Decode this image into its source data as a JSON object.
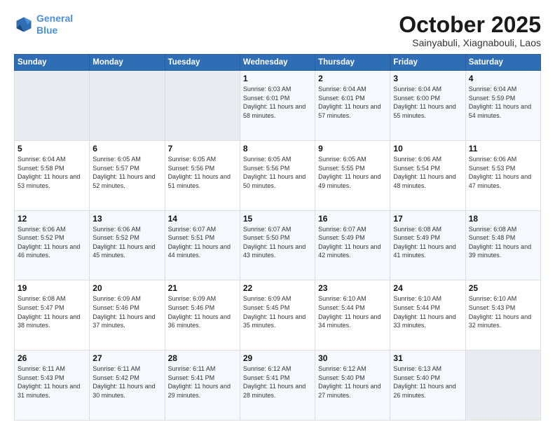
{
  "header": {
    "logo_line1": "General",
    "logo_line2": "Blue",
    "month_title": "October 2025",
    "location": "Sainyabuli, Xiagnabouli, Laos"
  },
  "weekdays": [
    "Sunday",
    "Monday",
    "Tuesday",
    "Wednesday",
    "Thursday",
    "Friday",
    "Saturday"
  ],
  "weeks": [
    [
      {
        "day": "",
        "sunrise": "",
        "sunset": "",
        "daylight": ""
      },
      {
        "day": "",
        "sunrise": "",
        "sunset": "",
        "daylight": ""
      },
      {
        "day": "",
        "sunrise": "",
        "sunset": "",
        "daylight": ""
      },
      {
        "day": "1",
        "sunrise": "Sunrise: 6:03 AM",
        "sunset": "Sunset: 6:01 PM",
        "daylight": "Daylight: 11 hours and 58 minutes."
      },
      {
        "day": "2",
        "sunrise": "Sunrise: 6:04 AM",
        "sunset": "Sunset: 6:01 PM",
        "daylight": "Daylight: 11 hours and 57 minutes."
      },
      {
        "day": "3",
        "sunrise": "Sunrise: 6:04 AM",
        "sunset": "Sunset: 6:00 PM",
        "daylight": "Daylight: 11 hours and 55 minutes."
      },
      {
        "day": "4",
        "sunrise": "Sunrise: 6:04 AM",
        "sunset": "Sunset: 5:59 PM",
        "daylight": "Daylight: 11 hours and 54 minutes."
      }
    ],
    [
      {
        "day": "5",
        "sunrise": "Sunrise: 6:04 AM",
        "sunset": "Sunset: 5:58 PM",
        "daylight": "Daylight: 11 hours and 53 minutes."
      },
      {
        "day": "6",
        "sunrise": "Sunrise: 6:05 AM",
        "sunset": "Sunset: 5:57 PM",
        "daylight": "Daylight: 11 hours and 52 minutes."
      },
      {
        "day": "7",
        "sunrise": "Sunrise: 6:05 AM",
        "sunset": "Sunset: 5:56 PM",
        "daylight": "Daylight: 11 hours and 51 minutes."
      },
      {
        "day": "8",
        "sunrise": "Sunrise: 6:05 AM",
        "sunset": "Sunset: 5:56 PM",
        "daylight": "Daylight: 11 hours and 50 minutes."
      },
      {
        "day": "9",
        "sunrise": "Sunrise: 6:05 AM",
        "sunset": "Sunset: 5:55 PM",
        "daylight": "Daylight: 11 hours and 49 minutes."
      },
      {
        "day": "10",
        "sunrise": "Sunrise: 6:06 AM",
        "sunset": "Sunset: 5:54 PM",
        "daylight": "Daylight: 11 hours and 48 minutes."
      },
      {
        "day": "11",
        "sunrise": "Sunrise: 6:06 AM",
        "sunset": "Sunset: 5:53 PM",
        "daylight": "Daylight: 11 hours and 47 minutes."
      }
    ],
    [
      {
        "day": "12",
        "sunrise": "Sunrise: 6:06 AM",
        "sunset": "Sunset: 5:52 PM",
        "daylight": "Daylight: 11 hours and 46 minutes."
      },
      {
        "day": "13",
        "sunrise": "Sunrise: 6:06 AM",
        "sunset": "Sunset: 5:52 PM",
        "daylight": "Daylight: 11 hours and 45 minutes."
      },
      {
        "day": "14",
        "sunrise": "Sunrise: 6:07 AM",
        "sunset": "Sunset: 5:51 PM",
        "daylight": "Daylight: 11 hours and 44 minutes."
      },
      {
        "day": "15",
        "sunrise": "Sunrise: 6:07 AM",
        "sunset": "Sunset: 5:50 PM",
        "daylight": "Daylight: 11 hours and 43 minutes."
      },
      {
        "day": "16",
        "sunrise": "Sunrise: 6:07 AM",
        "sunset": "Sunset: 5:49 PM",
        "daylight": "Daylight: 11 hours and 42 minutes."
      },
      {
        "day": "17",
        "sunrise": "Sunrise: 6:08 AM",
        "sunset": "Sunset: 5:49 PM",
        "daylight": "Daylight: 11 hours and 41 minutes."
      },
      {
        "day": "18",
        "sunrise": "Sunrise: 6:08 AM",
        "sunset": "Sunset: 5:48 PM",
        "daylight": "Daylight: 11 hours and 39 minutes."
      }
    ],
    [
      {
        "day": "19",
        "sunrise": "Sunrise: 6:08 AM",
        "sunset": "Sunset: 5:47 PM",
        "daylight": "Daylight: 11 hours and 38 minutes."
      },
      {
        "day": "20",
        "sunrise": "Sunrise: 6:09 AM",
        "sunset": "Sunset: 5:46 PM",
        "daylight": "Daylight: 11 hours and 37 minutes."
      },
      {
        "day": "21",
        "sunrise": "Sunrise: 6:09 AM",
        "sunset": "Sunset: 5:46 PM",
        "daylight": "Daylight: 11 hours and 36 minutes."
      },
      {
        "day": "22",
        "sunrise": "Sunrise: 6:09 AM",
        "sunset": "Sunset: 5:45 PM",
        "daylight": "Daylight: 11 hours and 35 minutes."
      },
      {
        "day": "23",
        "sunrise": "Sunrise: 6:10 AM",
        "sunset": "Sunset: 5:44 PM",
        "daylight": "Daylight: 11 hours and 34 minutes."
      },
      {
        "day": "24",
        "sunrise": "Sunrise: 6:10 AM",
        "sunset": "Sunset: 5:44 PM",
        "daylight": "Daylight: 11 hours and 33 minutes."
      },
      {
        "day": "25",
        "sunrise": "Sunrise: 6:10 AM",
        "sunset": "Sunset: 5:43 PM",
        "daylight": "Daylight: 11 hours and 32 minutes."
      }
    ],
    [
      {
        "day": "26",
        "sunrise": "Sunrise: 6:11 AM",
        "sunset": "Sunset: 5:43 PM",
        "daylight": "Daylight: 11 hours and 31 minutes."
      },
      {
        "day": "27",
        "sunrise": "Sunrise: 6:11 AM",
        "sunset": "Sunset: 5:42 PM",
        "daylight": "Daylight: 11 hours and 30 minutes."
      },
      {
        "day": "28",
        "sunrise": "Sunrise: 6:11 AM",
        "sunset": "Sunset: 5:41 PM",
        "daylight": "Daylight: 11 hours and 29 minutes."
      },
      {
        "day": "29",
        "sunrise": "Sunrise: 6:12 AM",
        "sunset": "Sunset: 5:41 PM",
        "daylight": "Daylight: 11 hours and 28 minutes."
      },
      {
        "day": "30",
        "sunrise": "Sunrise: 6:12 AM",
        "sunset": "Sunset: 5:40 PM",
        "daylight": "Daylight: 11 hours and 27 minutes."
      },
      {
        "day": "31",
        "sunrise": "Sunrise: 6:13 AM",
        "sunset": "Sunset: 5:40 PM",
        "daylight": "Daylight: 11 hours and 26 minutes."
      },
      {
        "day": "",
        "sunrise": "",
        "sunset": "",
        "daylight": ""
      }
    ]
  ]
}
